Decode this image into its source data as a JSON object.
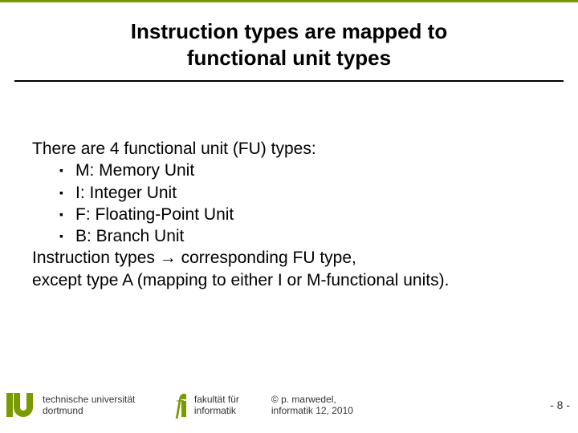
{
  "header": {
    "title_line1": "Instruction types are mapped to",
    "title_line2": "functional unit types"
  },
  "content": {
    "intro": "There are 4 functional unit (FU) types:",
    "bullets": [
      "M: Memory Unit",
      "I: Integer Unit",
      "F: Floating-Point Unit",
      "B: Branch Unit"
    ],
    "outro_line1": "Instruction types → corresponding FU type,",
    "outro_line2": "except type A (mapping to either I or M-functional units)."
  },
  "footer": {
    "uni_line1": "technische universität",
    "uni_line2": "dortmund",
    "fac_line1": "fakultät für",
    "fac_line2": "informatik",
    "copy_line1": "© p. marwedel,",
    "copy_line2": "informatik 12, 2010",
    "page": "- 8 -"
  }
}
